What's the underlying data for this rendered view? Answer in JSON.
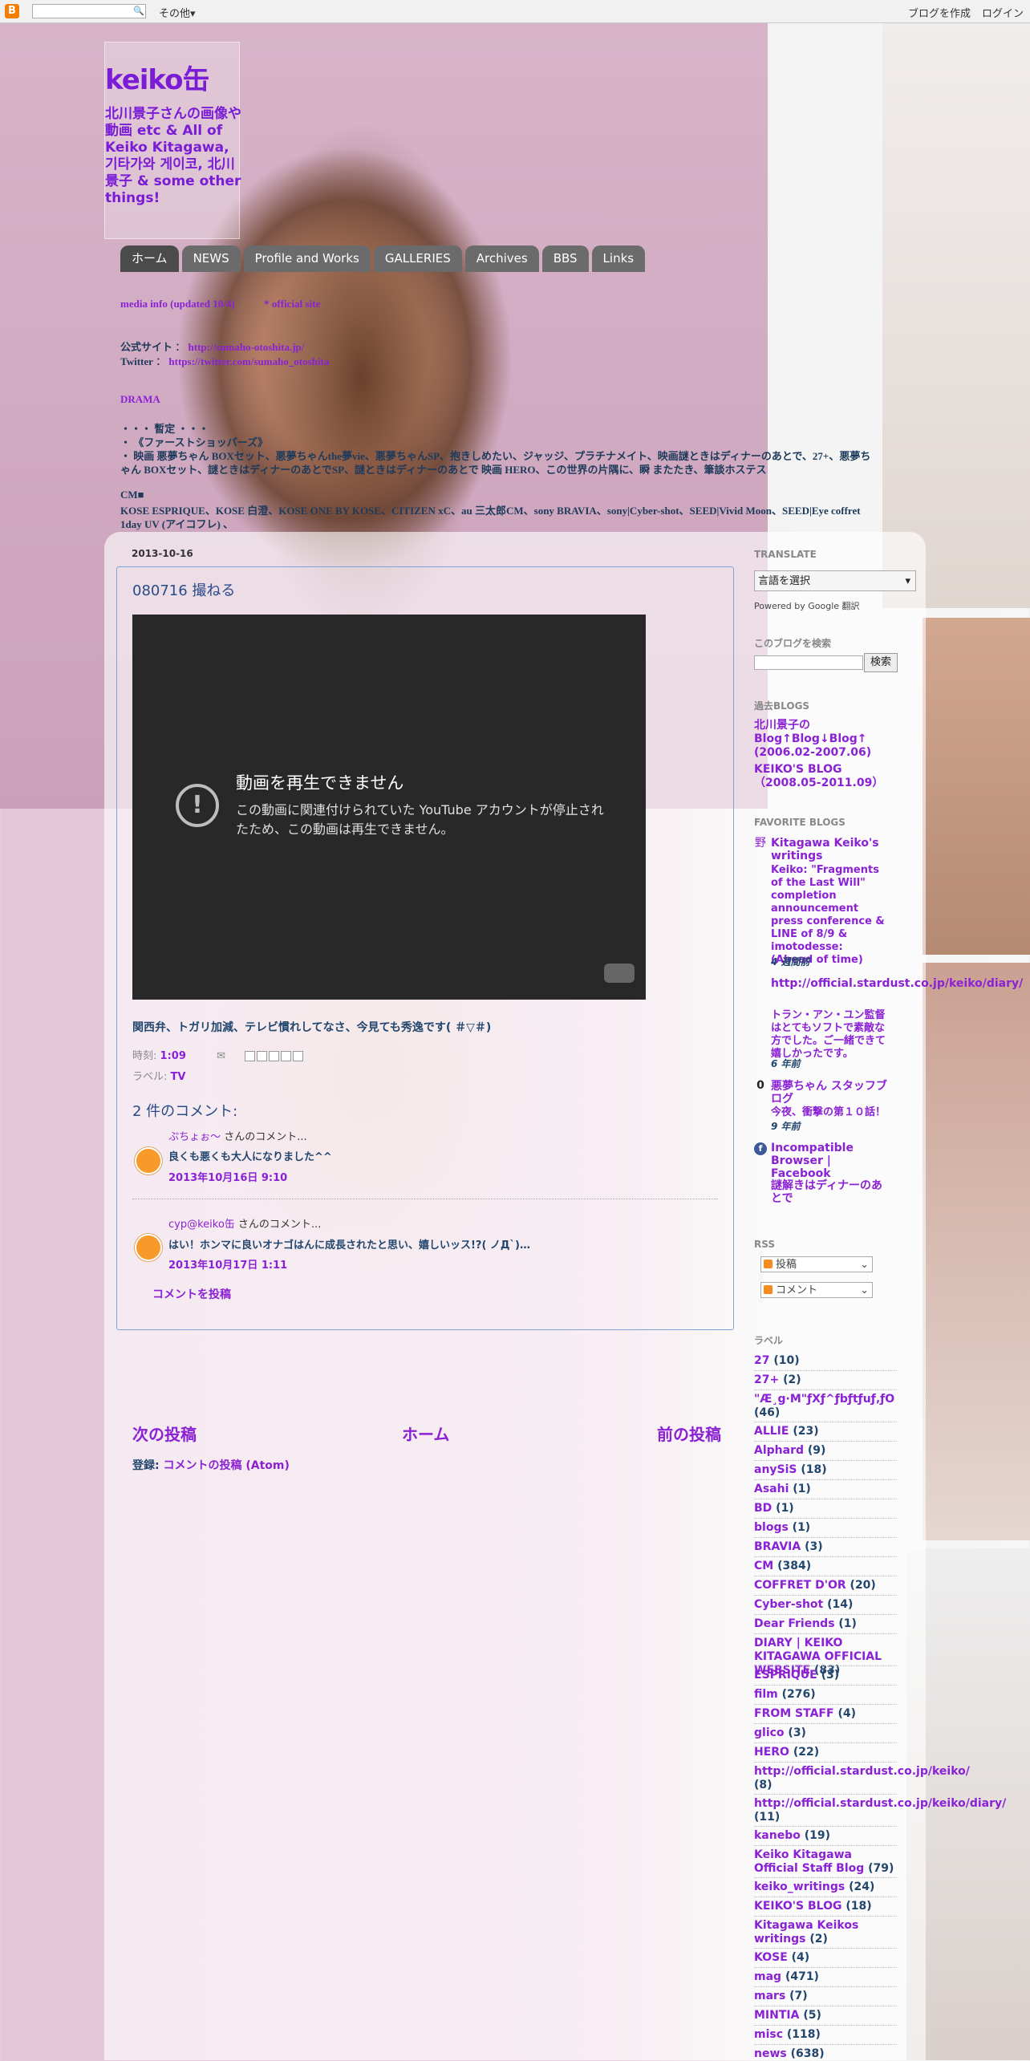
{
  "navbar": {
    "logo": "B",
    "more": "その他▾",
    "create_blog": "ブログを作成",
    "login": "ログイン"
  },
  "header": {
    "title": "keiko缶",
    "description": "北川景子さんの画像や動画 etc & All of Keiko Kitagawa, 기타가와 게이코, 北川景子 & some other things!"
  },
  "tabs": [
    "ホーム",
    "NEWS",
    "Profile and Works",
    "GALLERIES",
    "Archives",
    "BBS",
    "Links"
  ],
  "top_info": {
    "line1_a": "media info (updated 10/4)",
    "line1_b": "* official site",
    "line2_label": "公式サイト",
    "line2_url": "http://sumaho-otoshita.jp/",
    "line3_label": "Twitter",
    "line3_url": "https://twitter.com/sumaho_otoshita",
    "drama": "DRAMA",
    "line5": "・・・ 暫定 ・・・",
    "line6": "・ 《ファーストショッパーズ》",
    "line7": "・ 映画 悪夢ちゃん BOXセット、悪夢ちゃんthe夢vie、悪夢ちゃんSP、抱きしめたい、ジャッジ、プラチナメイト、映画謎ときはディナーのあとで、27+、悪夢ち",
    "line8": "ゃん BOXセット、謎ときはディナーのあとでSP、謎ときはディナーのあとで 映画 HERO、この世界の片隅に、瞬 またたき、筆談ホステス",
    "cm": "CM■",
    "line10": "KOSE ESPRIQUE、KOSE 白澄、KOSE ONE BY KOSE、CITIZEN xC、au 三太郎CM、sony BRAVIA、sony|Cyber-shot、SEED|Vivid Moon、SEED|Eye coffret",
    "line11": "1day UV (アイコフレ) 、"
  },
  "post": {
    "date": "2013-10-16",
    "title": "080716 撮ねる",
    "video_error_title": "動画を再生できません",
    "video_error_msg": "この動画に関連付けられていた YouTube アカウントが停止されたため、この動画は再生できません。",
    "body": "関西弁、トガリ加減、テレビ慣れしてなさ、今見ても秀逸です( ＃▽＃)",
    "time_label": "時刻:",
    "time": "1:09",
    "labels_label": "ラベル:",
    "label": "TV",
    "comments_heading": "2 件のコメント:",
    "add_comment": "コメントを投稿"
  },
  "comments": [
    {
      "author": "ぷちょぉ～",
      "suffix": " さんのコメント...",
      "text": "良くも悪くも大人になりました^^",
      "time": "2013年10月16日 9:10"
    },
    {
      "author": "cyp@keiko缶",
      "suffix": " さんのコメント...",
      "text": "はい！ホンマに良いオナゴはんに成長されたと思い、嬉しいッス!?( ノД`)…",
      "time": "2013年10月17日 1:11"
    }
  ],
  "pager": {
    "newer": "次の投稿",
    "home": "ホーム",
    "older": "前の投稿",
    "subscribe_label": "登録:",
    "subscribe_link": "コメントの投稿 (Atom)"
  },
  "sidebar": {
    "translate_head": "TRANSLATE",
    "translate_select": "言語を選択",
    "powered": "Powered by Google 翻訳",
    "search_head": "このブログを検索",
    "search_button": "検索",
    "past_head": "過去BLOGS",
    "past": [
      "北川景子の Blog↑Blog↓Blog↑ (2006.02-2007.06)",
      "KEIKO'S BLOG（2008.05-2011.09）"
    ],
    "fav_head": "FAVORITE BLOGS",
    "fav": [
      {
        "title": "Kitagawa Keiko's writings",
        "snip": "Keiko: \"Fragments of the Last Will\" completion announcement press conference & LINE of 8/9 & imotodesse: (Ahead of time)",
        "time": "4 週間前"
      },
      {
        "title": "http://official.stardust.co.jp/keiko/diary/",
        "snip": "トラン・アン・ユン監督はとてもソフトで素敵な方でした。ご一緒できて嬉しかったです。",
        "time": "6 年前"
      },
      {
        "title": "悪夢ちゃん スタッフブログ",
        "snip": "今夜、衝撃の第１０話！",
        "time": "9 年前"
      },
      {
        "title": "Incompatible Browser | Facebook",
        "snip": "",
        "time": ""
      },
      {
        "title": "謎解きはディナーのあとで",
        "snip": "",
        "time": ""
      }
    ],
    "rss_head": "RSS",
    "rss": [
      "投稿",
      "コメント"
    ],
    "labels_head": "ラベル",
    "labels": [
      [
        "27",
        "(10)"
      ],
      [
        "27+",
        "(2)"
      ],
      [
        "\"Æ¸g·M\"ƒXƒ^ƒbƒtƒuƒ‚ƒO",
        "(46)"
      ],
      [
        "ALLIE",
        "(23)"
      ],
      [
        "Alphard",
        "(9)"
      ],
      [
        "anySiS",
        "(18)"
      ],
      [
        "Asahi",
        "(1)"
      ],
      [
        "BD",
        "(1)"
      ],
      [
        "blogs",
        "(1)"
      ],
      [
        "BRAVIA",
        "(3)"
      ],
      [
        "CM",
        "(384)"
      ],
      [
        "COFFRET D'OR",
        "(20)"
      ],
      [
        "Cyber-shot",
        "(14)"
      ],
      [
        "Dear Friends",
        "(1)"
      ],
      [
        "DIARY | KEIKO KITAGAWA OFFICIAL WEBSITE",
        "(83)"
      ],
      [
        "ESPRIQUE",
        "(3)"
      ],
      [
        "film",
        "(276)"
      ],
      [
        "FROM STAFF",
        "(4)"
      ],
      [
        "glico",
        "(3)"
      ],
      [
        "HERO",
        "(22)"
      ],
      [
        "http://official.stardust.co.jp/keiko/",
        "(8)"
      ],
      [
        "http://official.stardust.co.jp/keiko/diary/",
        "(11)"
      ],
      [
        "kanebo",
        "(19)"
      ],
      [
        "Keiko Kitagawa Official Staff Blog",
        "(79)"
      ],
      [
        "keiko_writings",
        "(24)"
      ],
      [
        "KEIKO'S BLOG",
        "(18)"
      ],
      [
        "Kitagawa Keikos writings",
        "(2)"
      ],
      [
        "KOSE",
        "(4)"
      ],
      [
        "mag",
        "(471)"
      ],
      [
        "mars",
        "(7)"
      ],
      [
        "MINTIA",
        "(5)"
      ],
      [
        "misc",
        "(118)"
      ],
      [
        "news",
        "(638)"
      ]
    ]
  }
}
